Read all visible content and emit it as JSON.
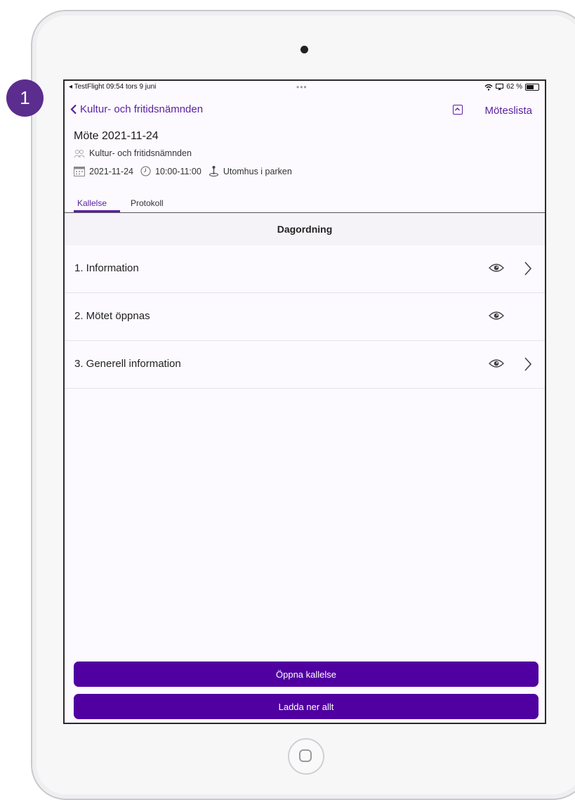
{
  "step_number": "1",
  "status_bar": {
    "left": "◂ TestFlight  09:54  tors 9 juni",
    "dots": "•••",
    "battery": "62 %",
    "battery_level": 0.62
  },
  "nav": {
    "back_label": "Kultur- och fritidsnämnden",
    "right_label": "Möteslista"
  },
  "meeting": {
    "title": "Möte 2021-11-24",
    "committee": "Kultur- och fritidsnämnden",
    "date": "2021-11-24",
    "time": "10:00-11:00",
    "location": "Utomhus i parken"
  },
  "tabs": [
    {
      "label": "Kallelse",
      "active": true
    },
    {
      "label": "Protokoll",
      "active": false
    }
  ],
  "agenda": {
    "header": "Dagordning",
    "items": [
      {
        "label": "1. Information",
        "has_chevron": true
      },
      {
        "label": "2. Mötet öppnas",
        "has_chevron": false
      },
      {
        "label": "3. Generell information",
        "has_chevron": true
      }
    ]
  },
  "buttons": {
    "open_notice": "Öppna kallelse",
    "download_all": "Ladda ner allt"
  },
  "icons": [
    "chevron-left-icon",
    "collapse-icon",
    "people-icon",
    "calendar-icon",
    "clock-icon",
    "location-pin-icon",
    "eye-icon",
    "chevron-right-icon",
    "wifi-icon",
    "screen-mirror-icon",
    "battery-icon"
  ],
  "colors": {
    "accent": "#5b1fa0",
    "button": "#5000a0",
    "badge": "#5b2d8e"
  }
}
